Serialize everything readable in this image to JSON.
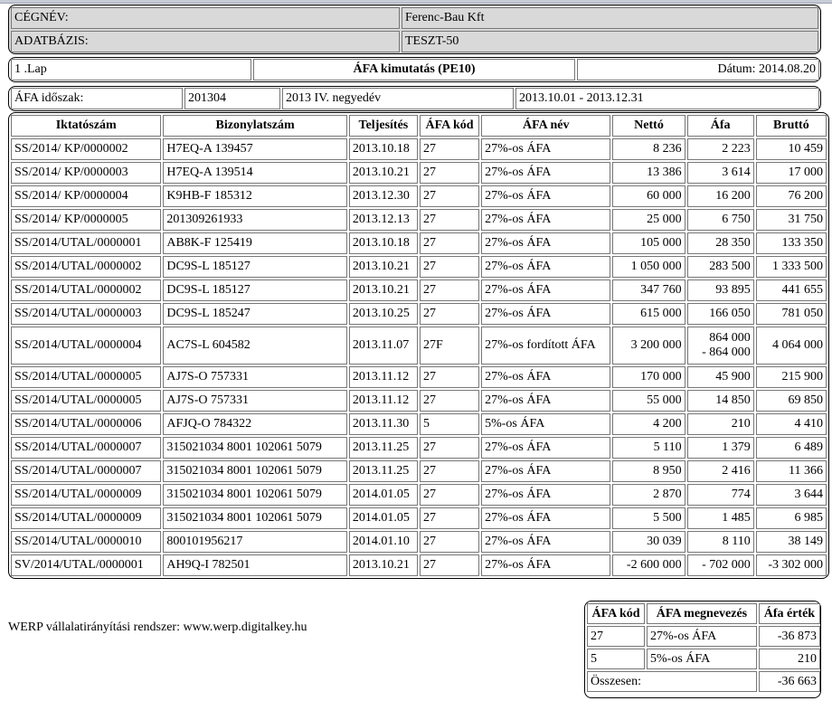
{
  "header": {
    "company_label": "CÉGNÉV:",
    "company_value": "Ferenc-Bau Kft",
    "db_label": "ADATBÁZIS:",
    "db_value": "TESZT-50"
  },
  "titlebar": {
    "page": "1 .Lap",
    "title": "ÁFA kimutatás (PE10)",
    "date": "Dátum: 2014.08.20"
  },
  "period": {
    "label": "ÁFA időszak:",
    "code": "201304",
    "name": "2013 IV. negyedév",
    "range": "2013.10.01 - 2013.12.31"
  },
  "table": {
    "columns": [
      "Iktatószám",
      "Bizonylatszám",
      "Teljesítés",
      "ÁFA kód",
      "ÁFA név",
      "Nettó",
      "Áfa",
      "Bruttó"
    ],
    "rows": [
      [
        "SS/2014/ KP/0000002",
        "H7EQ-A 139457",
        "2013.10.18",
        "27",
        "27%-os ÁFA",
        "8 236",
        "2 223",
        "10 459"
      ],
      [
        "SS/2014/ KP/0000003",
        "H7EQ-A 139514",
        "2013.10.21",
        "27",
        "27%-os ÁFA",
        "13 386",
        "3 614",
        "17 000"
      ],
      [
        "SS/2014/ KP/0000004",
        "K9HB-F 185312",
        "2013.12.30",
        "27",
        "27%-os ÁFA",
        "60 000",
        "16 200",
        "76 200"
      ],
      [
        "SS/2014/ KP/0000005",
        "201309261933",
        "2013.12.13",
        "27",
        "27%-os ÁFA",
        "25 000",
        "6 750",
        "31 750"
      ],
      [
        "SS/2014/UTAL/0000001",
        "AB8K-F 125419",
        "2013.10.18",
        "27",
        "27%-os ÁFA",
        "105 000",
        "28 350",
        "133 350"
      ],
      [
        "SS/2014/UTAL/0000002",
        "DC9S-L 185127",
        "2013.10.21",
        "27",
        "27%-os ÁFA",
        "1 050 000",
        "283 500",
        "1 333 500"
      ],
      [
        "SS/2014/UTAL/0000002",
        "DC9S-L 185127",
        "2013.10.21",
        "27",
        "27%-os ÁFA",
        "347 760",
        "93 895",
        "441 655"
      ],
      [
        "SS/2014/UTAL/0000003",
        "DC9S-L 185247",
        "2013.10.25",
        "27",
        "27%-os ÁFA",
        "615 000",
        "166 050",
        "781 050"
      ],
      [
        "SS/2014/UTAL/0000004",
        "AC7S-L 604582",
        "2013.11.07",
        "27F",
        "27%-os fordított ÁFA",
        "3 200 000",
        "864 000\n- 864 000",
        "4 064 000"
      ],
      [
        "SS/2014/UTAL/0000005",
        "AJ7S-O 757331",
        "2013.11.12",
        "27",
        "27%-os ÁFA",
        "170 000",
        "45 900",
        "215 900"
      ],
      [
        "SS/2014/UTAL/0000005",
        "AJ7S-O 757331",
        "2013.11.12",
        "27",
        "27%-os ÁFA",
        "55 000",
        "14 850",
        "69 850"
      ],
      [
        "SS/2014/UTAL/0000006",
        "AFJQ-O 784322",
        "2013.11.30",
        "5",
        "5%-os ÁFA",
        "4 200",
        "210",
        "4 410"
      ],
      [
        "SS/2014/UTAL/0000007",
        "315021034 8001 102061 5079",
        "2013.11.25",
        "27",
        "27%-os ÁFA",
        "5 110",
        "1 379",
        "6 489"
      ],
      [
        "SS/2014/UTAL/0000007",
        "315021034 8001 102061 5079",
        "2013.11.25",
        "27",
        "27%-os ÁFA",
        "8 950",
        "2 416",
        "11 366"
      ],
      [
        "SS/2014/UTAL/0000009",
        "315021034 8001 102061 5079",
        "2014.01.05",
        "27",
        "27%-os ÁFA",
        "2 870",
        "774",
        "3 644"
      ],
      [
        "SS/2014/UTAL/0000009",
        "315021034 8001 102061 5079",
        "2014.01.05",
        "27",
        "27%-os ÁFA",
        "5 500",
        "1 485",
        "6 985"
      ],
      [
        "SS/2014/UTAL/0000010",
        "800101956217",
        "2014.01.10",
        "27",
        "27%-os ÁFA",
        "30 039",
        "8 110",
        "38 149"
      ],
      [
        "SV/2014/UTAL/0000001",
        "AH9Q-I 782501",
        "2013.10.21",
        "27",
        "27%-os ÁFA",
        "-2 600 000",
        "- 702 000",
        "-3 302 000"
      ]
    ]
  },
  "footer_text": "WERP vállalatirányítási rendszer: www.werp.digitalkey.hu",
  "summary": {
    "columns": [
      "ÁFA kód",
      "ÁFA megnevezés",
      "Áfa érték"
    ],
    "rows": [
      [
        "27",
        "27%-os ÁFA",
        "-36 873"
      ],
      [
        "5",
        "5%-os ÁFA",
        "210"
      ]
    ],
    "total_label": "Összesen:",
    "total_value": "-36 663"
  }
}
